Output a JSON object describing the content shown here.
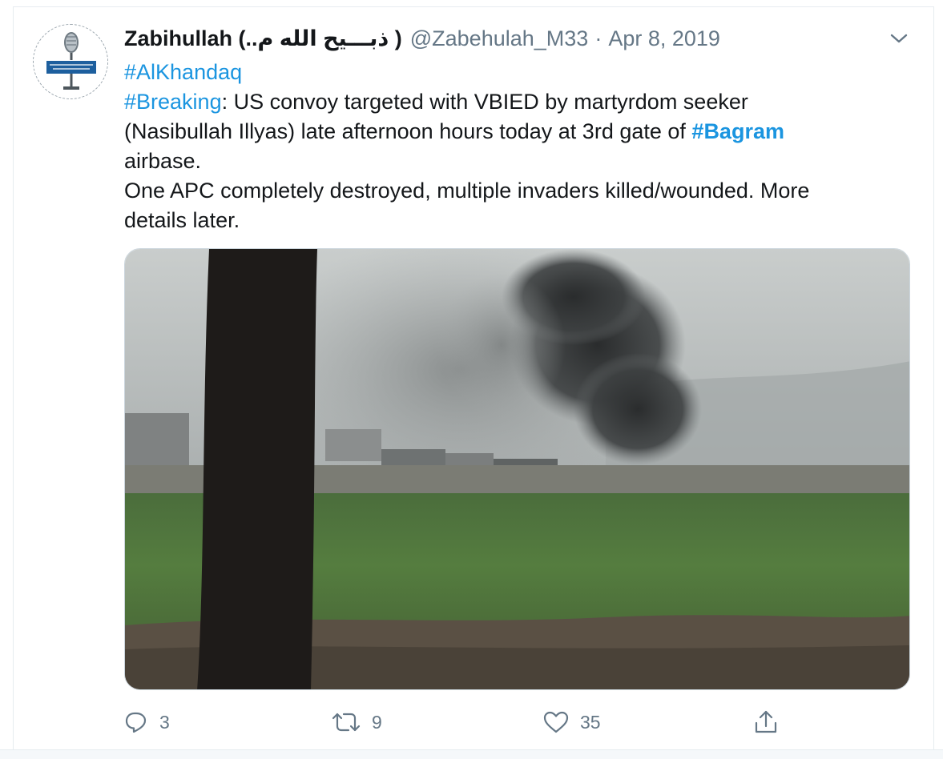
{
  "tweet": {
    "author": {
      "display_name": "Zabihullah (..ذبـــيح الله م )",
      "handle": "@Zabehulah_M33",
      "separator": "·",
      "date": "Apr 8, 2019",
      "avatar_icon": "microphone-logo-icon"
    },
    "menu_icon": "chevron-down-icon",
    "text": {
      "tag_line": "#AlKhandaq",
      "line2_tag": "#Breaking",
      "line2_rest": ": US convoy targeted with VBIED by martyrdom seeker",
      "line3_pre": "(Nasibullah Illyas) late afternoon hours today at 3rd gate of ",
      "line3_tag": "#Bagram",
      "line4": "airbase.",
      "line5": "One APC completely destroyed, multiple invaders killed/wounded. More",
      "line6": "details later."
    },
    "media": {
      "type": "photo",
      "description_icon": "smoke-photo"
    },
    "actions": {
      "reply_count": "3",
      "retweet_count": "9",
      "like_count": "35"
    },
    "colors": {
      "link": "#1b95e0",
      "secondary_text": "#657786",
      "primary_text": "#14171a",
      "border": "#e6ecf0"
    }
  }
}
